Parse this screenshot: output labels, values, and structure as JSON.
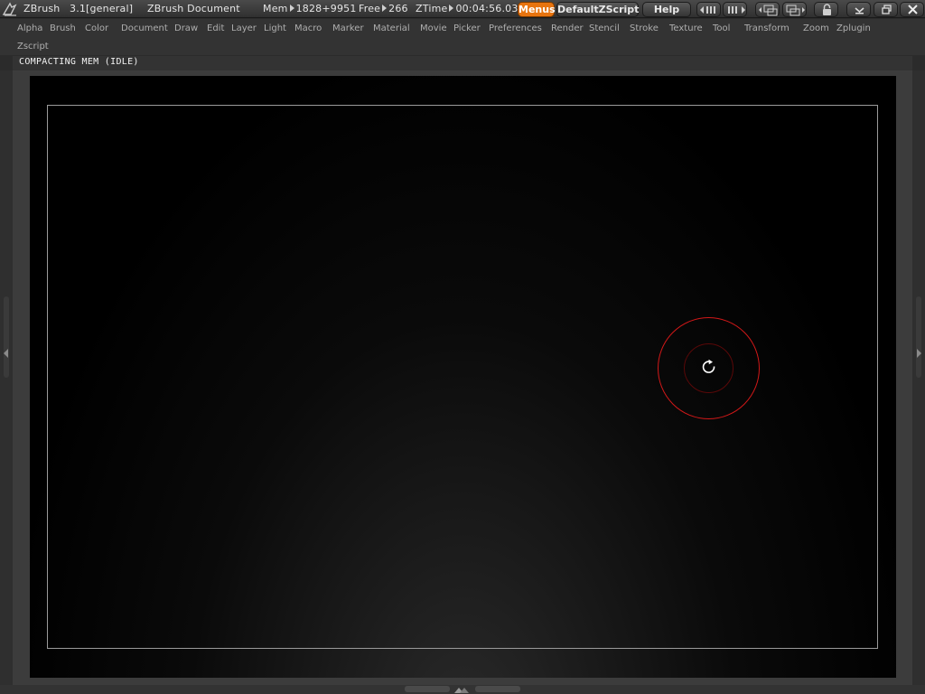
{
  "titlebar": {
    "app_name": "ZBrush",
    "version": "3.1",
    "mode": "[general]",
    "document_label": "ZBrush Document",
    "mem_label": "Mem",
    "mem_value": "1828+9951",
    "free_label": "Free",
    "free_value": "266",
    "ztime_label": "ZTime",
    "ztime_value": "00:04:56.03",
    "menus_button": "Menus",
    "script_button": "DefaultZScript",
    "help_button": "Help",
    "accent_color": "#e8740f"
  },
  "menubar": {
    "items": [
      "Alpha",
      "Brush",
      "Color",
      "Document",
      "Draw",
      "Edit",
      "Layer",
      "Light",
      "Macro",
      "Marker",
      "Material",
      "Movie",
      "Picker",
      "Preferences",
      "Render",
      "Stencil",
      "Stroke",
      "Texture",
      "Tool",
      "Transform",
      "Zoom",
      "Zplugin",
      "Zscript"
    ]
  },
  "status": {
    "text": "COMPACTING MEM (IDLE)"
  },
  "canvas": {
    "brush_ring_color": "#d11818"
  }
}
